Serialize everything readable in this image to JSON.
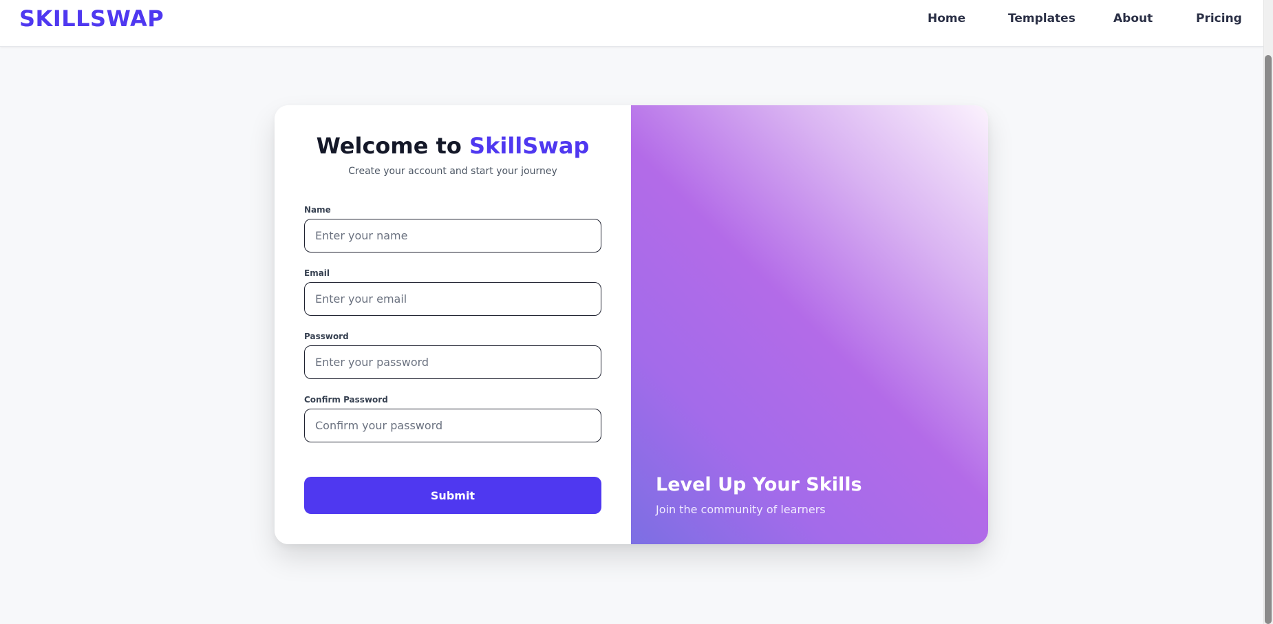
{
  "header": {
    "logo": "SKILLSWAP",
    "nav": [
      {
        "label": "Home"
      },
      {
        "label": "Templates"
      },
      {
        "label": "About"
      },
      {
        "label": "Pricing"
      }
    ]
  },
  "form": {
    "title_prefix": "Welcome to ",
    "title_brand": "SkillSwap",
    "subtitle": "Create your account and start your journey",
    "fields": [
      {
        "label": "Name",
        "placeholder": "Enter your name",
        "value": ""
      },
      {
        "label": "Email",
        "placeholder": "Enter your email",
        "value": ""
      },
      {
        "label": "Password",
        "placeholder": "Enter your password",
        "value": ""
      },
      {
        "label": "Confirm Password",
        "placeholder": "Confirm your password",
        "value": ""
      }
    ],
    "submit_label": "Submit"
  },
  "promo": {
    "title": "Level Up Your Skills",
    "subtitle": "Join the community of learners"
  },
  "colors": {
    "brand": "#4f38f0",
    "gradient": [
      "#7c6fe3",
      "#b36be8",
      "#fbf2fd"
    ]
  }
}
